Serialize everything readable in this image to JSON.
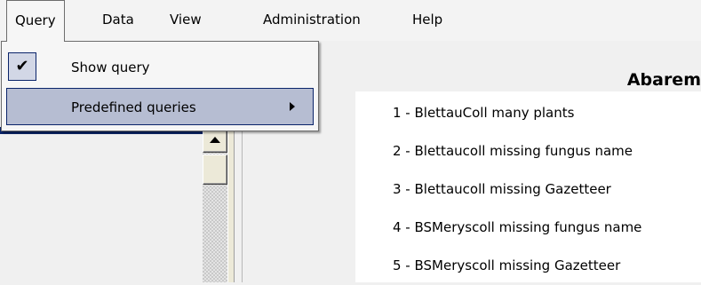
{
  "menubar": {
    "items": [
      {
        "label": "Query"
      },
      {
        "label": "Data"
      },
      {
        "label": "View"
      },
      {
        "label": "Administration"
      },
      {
        "label": "Help"
      }
    ]
  },
  "query_menu": {
    "items": [
      {
        "label": "Show query",
        "checked": true
      },
      {
        "label": "Predefined queries",
        "has_submenu": true,
        "highlighted": true
      }
    ]
  },
  "panel": {
    "title": "Abarem"
  },
  "predefined_queries": {
    "items": [
      "1 - BlettauColl many plants",
      "2 - Blettaucoll missing fungus name",
      "3 - Blettaucoll missing Gazetteer",
      "4 - BSMeryscoll missing fungus name",
      "5 - BSMeryscoll missing Gazetteer"
    ]
  },
  "icons": {
    "check": "checkmark-icon",
    "submenu_arrow": "chevron-right-icon",
    "scroll_up": "arrow-up-icon"
  },
  "colors": {
    "highlight_bg": "#b6bdd2",
    "highlight_border": "#0a246a",
    "selection": "#0a246a"
  }
}
